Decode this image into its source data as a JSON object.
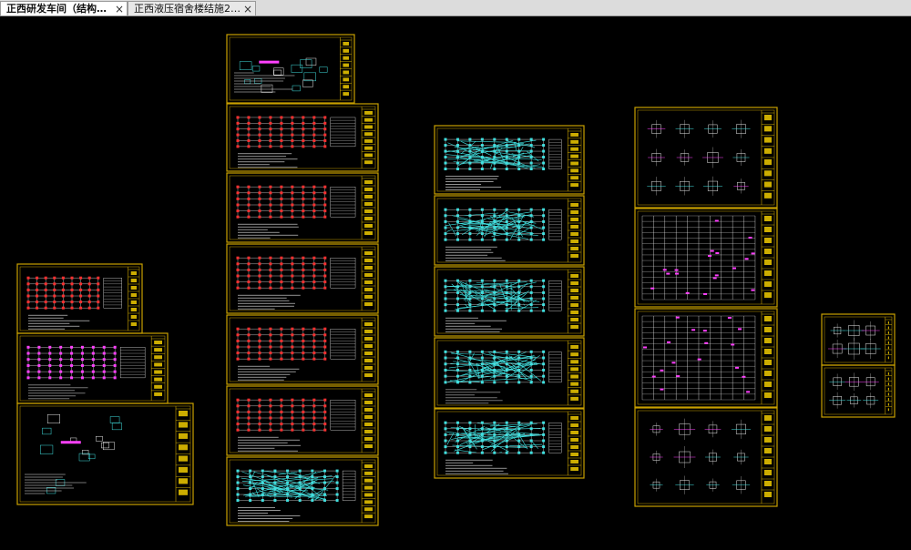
{
  "tabs": [
    {
      "label": "正西研发车间（结构…",
      "active": true,
      "close": "×"
    },
    {
      "label": "正西液压宿舍楼结施2…",
      "active": false,
      "close": "×"
    }
  ],
  "colors": {
    "background": "#000000",
    "frame": "#c8a000",
    "grid": "#e8e8e8",
    "columns_red": "#ff3030",
    "columns_magenta": "#ff40ff",
    "plan_cyan": "#40e0e0",
    "title_block": "#ffd800",
    "tab_active": "#ffffff",
    "tab_inactive": "#e8e8e8"
  }
}
